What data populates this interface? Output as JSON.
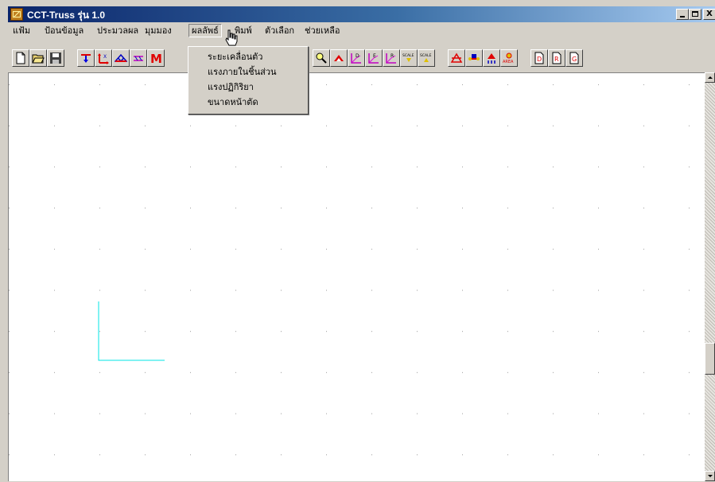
{
  "window": {
    "title": "CCT-Truss  รุ่น 1.0",
    "controls": {
      "minimize": "_",
      "maximize": "□",
      "close": "X"
    }
  },
  "menubar": {
    "items": [
      {
        "label": "แฟ้ม"
      },
      {
        "label": "ป้อนข้อมูล"
      },
      {
        "label": "ประมวลผล"
      },
      {
        "label": "มุมมอง"
      },
      {
        "label": "ผลลัพธ์"
      },
      {
        "label": "พิมพ์"
      },
      {
        "label": "ตัวเลือก"
      },
      {
        "label": "ช่วยเหลือ"
      }
    ],
    "open_menu_index": 4
  },
  "dropdown": {
    "items": [
      {
        "label": "ระยะเคลื่อนตัว"
      },
      {
        "label": "แรงภายในชิ้นส่วน"
      },
      {
        "label": "แรงปฏิกิริยา"
      },
      {
        "label": "ขนาดหน้าตัด"
      }
    ]
  },
  "toolbar": {
    "buttons": [
      {
        "icon": "new-file-icon"
      },
      {
        "icon": "open-folder-icon"
      },
      {
        "icon": "save-icon"
      },
      {
        "icon": "load-icon"
      },
      {
        "icon": "axis-icon"
      },
      {
        "icon": "truss-icon"
      },
      {
        "icon": "member-icon"
      },
      {
        "icon": "moment-icon",
        "text": "M"
      },
      {
        "icon": "zoom-icon"
      },
      {
        "icon": "support-icon"
      },
      {
        "icon": "displacement-graph-icon",
        "text": "D"
      },
      {
        "icon": "element-graph-icon",
        "text": "E"
      },
      {
        "icon": "reaction-graph-icon",
        "text": "R"
      },
      {
        "icon": "scale-up-icon",
        "text": "SCALE"
      },
      {
        "icon": "scale-down-icon",
        "text": "SCALE"
      },
      {
        "icon": "structure-icon"
      },
      {
        "icon": "section-icon"
      },
      {
        "icon": "reaction-support-icon"
      },
      {
        "icon": "area-icon",
        "text": "AREA"
      },
      {
        "icon": "report-d-icon",
        "text": "D"
      },
      {
        "icon": "report-r-icon",
        "text": "R"
      },
      {
        "icon": "report-g-icon",
        "text": "G"
      }
    ]
  },
  "colors": {
    "titlebar_start": "#0a246a",
    "titlebar_end": "#a6caf0",
    "axis_line": "#00e5e5",
    "grid_dot": "#9a9a9a"
  }
}
